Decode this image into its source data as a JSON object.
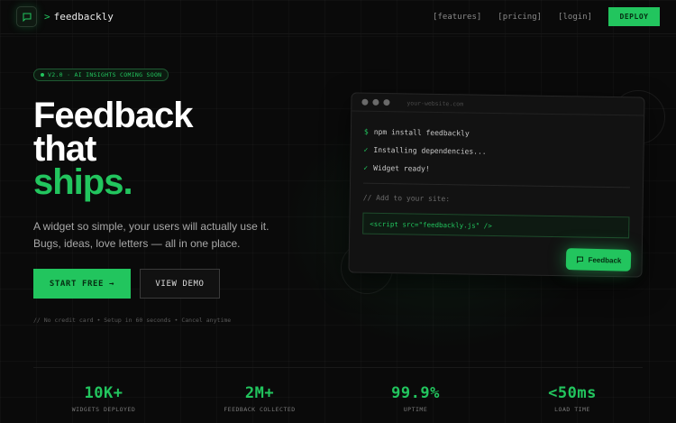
{
  "nav": {
    "logo_prompt": ">",
    "logo_text": "feedbackly",
    "links": [
      "[features]",
      "[pricing]",
      "[login]"
    ],
    "deploy_label": "DEPLOY"
  },
  "hero": {
    "badge": "V2.0 · AI INSIGHTS COMING SOON",
    "headline_line1": "Feedback",
    "headline_line2": "that",
    "headline_line3": "ships.",
    "subtitle_line1": "A widget so simple, your users will actually use it.",
    "subtitle_line2": "Bugs, ideas, love letters — all in one place.",
    "start_label": "START FREE →",
    "demo_label": "VIEW DEMO",
    "fineprint": "// No credit card • Setup in 60 seconds • Cancel anytime"
  },
  "terminal": {
    "url": "your-website.com",
    "prompt": "$",
    "command": "npm install feedbackly",
    "check": "✓",
    "line2": "Installing dependencies...",
    "line3": "Widget ready!",
    "comment": "// Add to your site:",
    "code": "<script src=\"feedbackly.js\" />"
  },
  "widget": {
    "label": "Feedback"
  },
  "stats": [
    {
      "value": "10K+",
      "label": "WIDGETS DEPLOYED"
    },
    {
      "value": "2M+",
      "label": "FEEDBACK COLLECTED"
    },
    {
      "value": "99.9%",
      "label": "UPTIME"
    },
    {
      "value": "<50ms",
      "label": "LOAD TIME"
    }
  ],
  "colors": {
    "accent": "#22c55e",
    "background": "#0a0a0a"
  }
}
